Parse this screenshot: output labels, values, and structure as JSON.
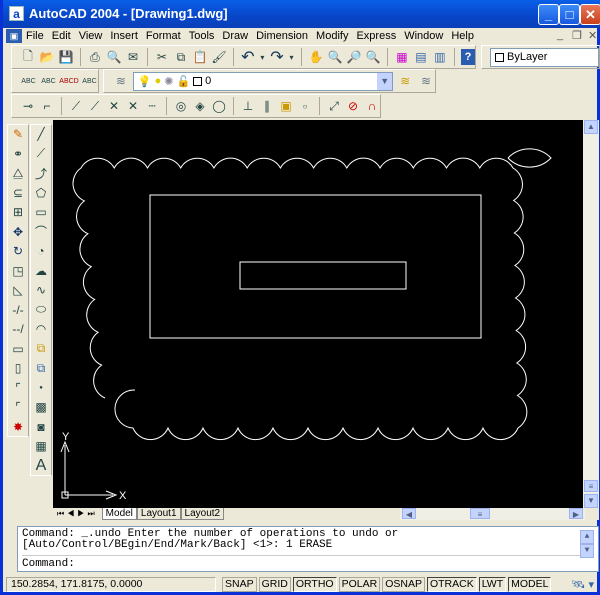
{
  "window": {
    "title": "AutoCAD 2004 - [Drawing1.dwg]",
    "minimize": "_",
    "maximize": "□",
    "close": "✕"
  },
  "menu": [
    "File",
    "Edit",
    "View",
    "Insert",
    "Format",
    "Tools",
    "Draw",
    "Dimension",
    "Modify",
    "Express",
    "Window",
    "Help"
  ],
  "mdi_controls": [
    "_",
    "❐",
    "✕"
  ],
  "properties": {
    "color": "ByLayer"
  },
  "layer": {
    "current": "0"
  },
  "layout_tabs": [
    "Model",
    "Layout1",
    "Layout2"
  ],
  "command": {
    "history": [
      "Command: _.undo Enter the number of operations to undo or",
      "[Auto/Control/BEgin/End/Mark/Back] <1>: 1 ERASE"
    ],
    "prompt": "Command:"
  },
  "status": {
    "coords": "150.2854, 171.8175, 0.0000",
    "toggles": [
      {
        "label": "SNAP",
        "on": false
      },
      {
        "label": "GRID",
        "on": false
      },
      {
        "label": "ORTHO",
        "on": true
      },
      {
        "label": "POLAR",
        "on": false
      },
      {
        "label": "OSNAP",
        "on": false
      },
      {
        "label": "OTRACK",
        "on": true
      },
      {
        "label": "LWT",
        "on": true
      },
      {
        "label": "MODEL",
        "on": true
      }
    ]
  },
  "ucs": {
    "x": "X",
    "y": "Y"
  },
  "colors": {
    "title": "#0747c6",
    "canvas": "#000000",
    "lines": "#ffffff"
  }
}
